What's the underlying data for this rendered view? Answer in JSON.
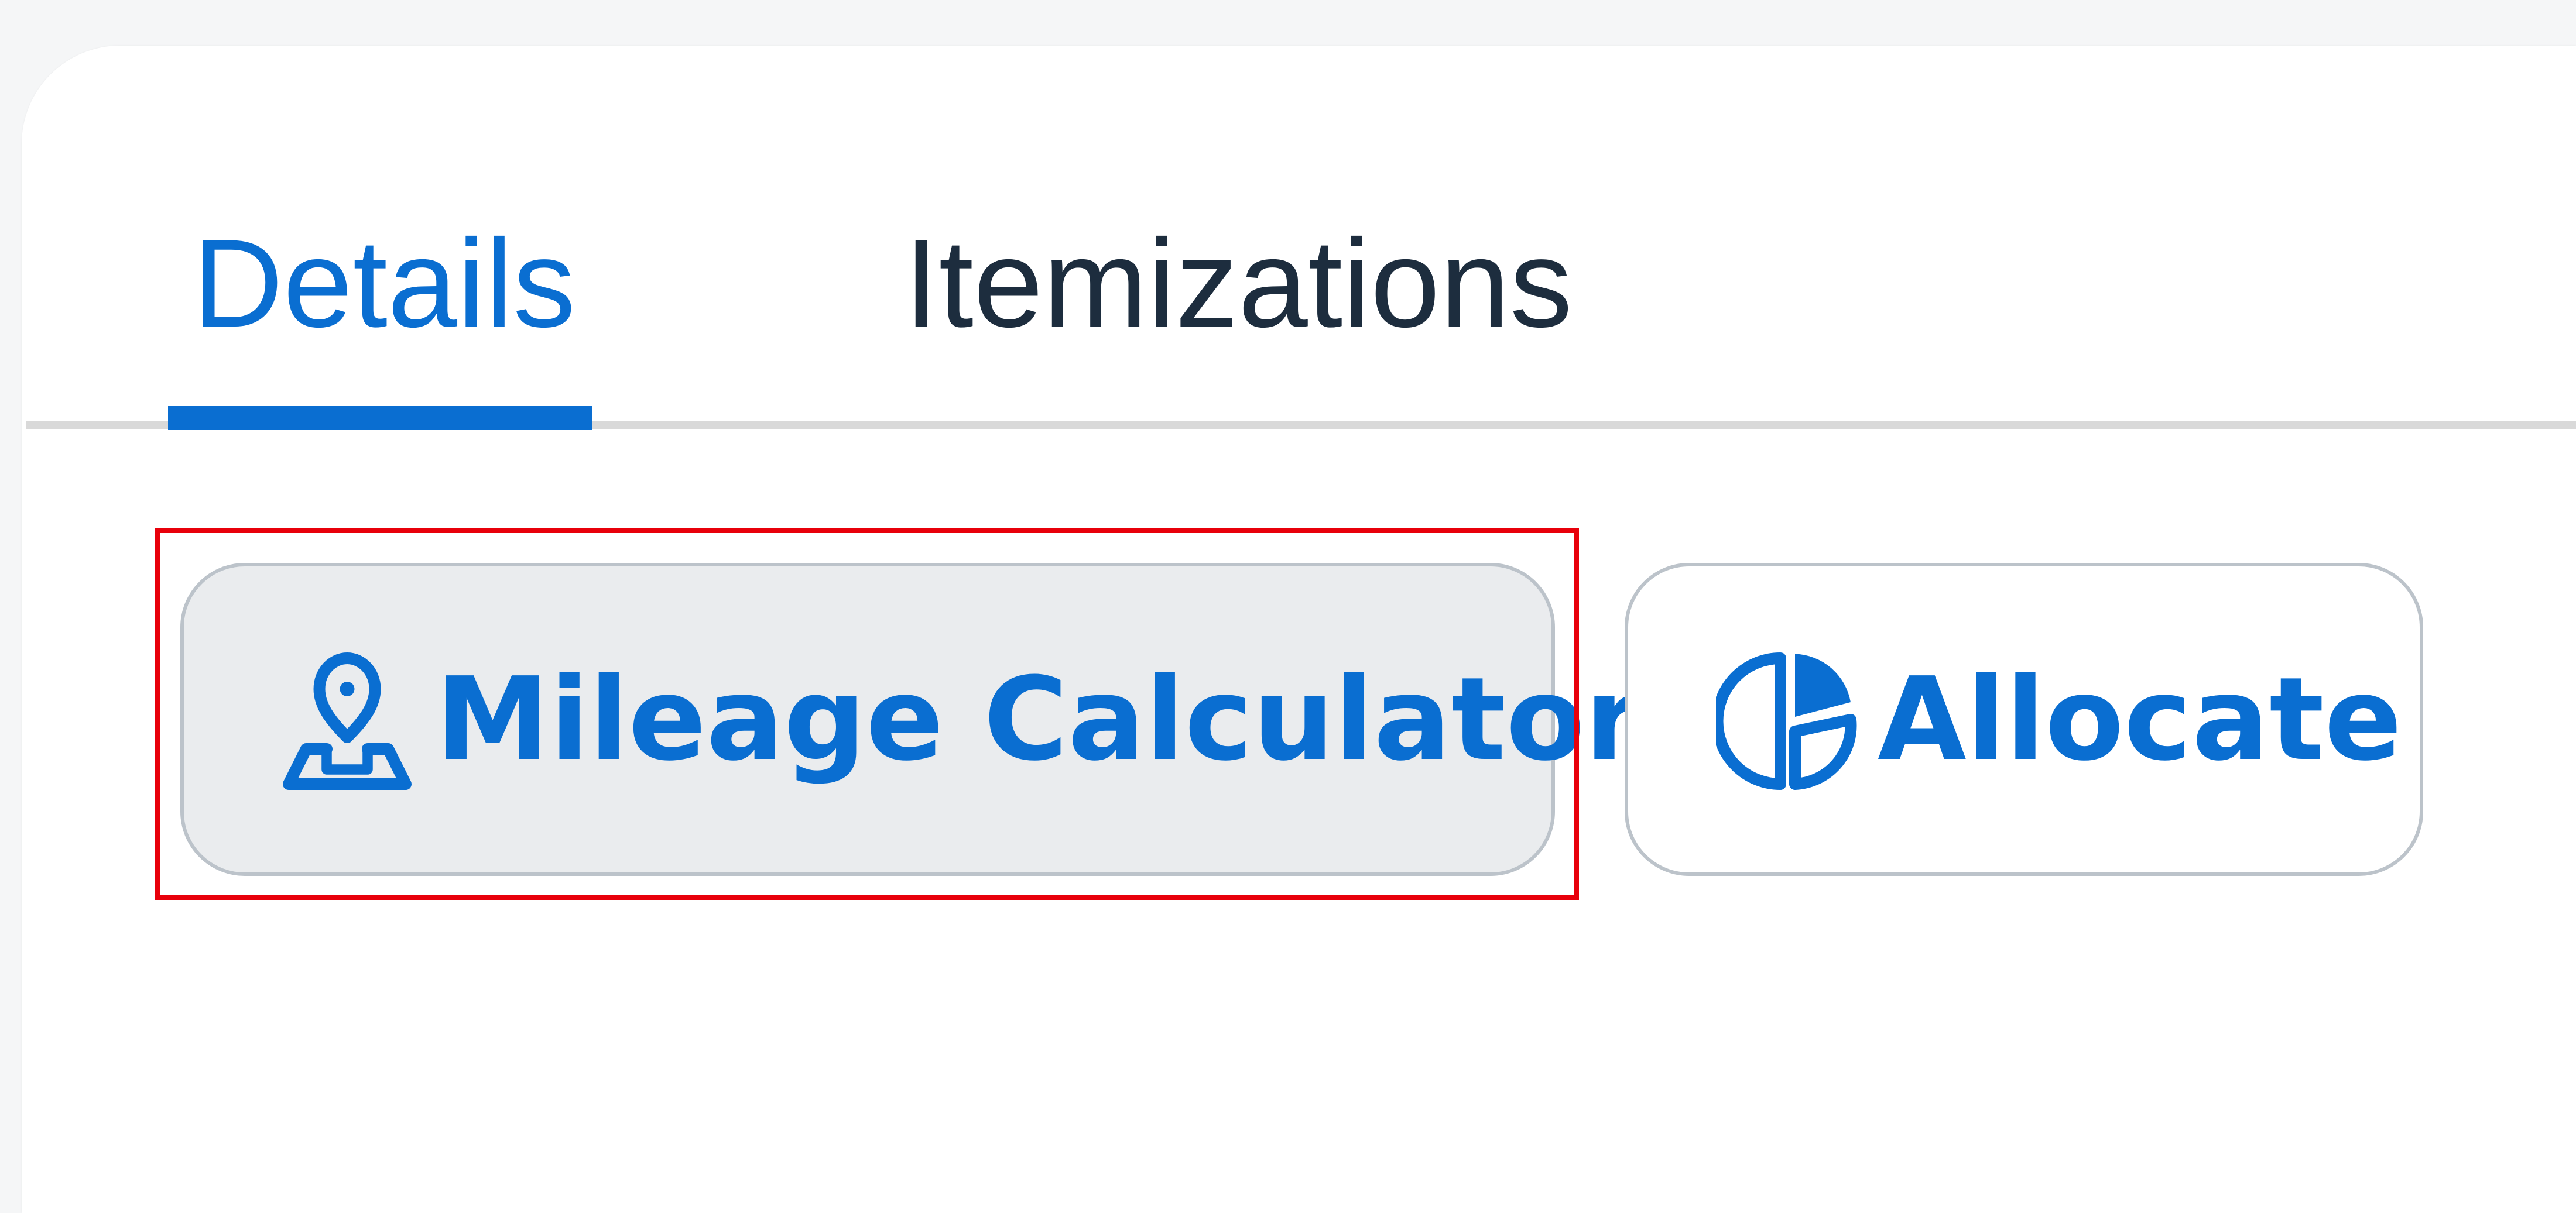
{
  "tabs": [
    {
      "label": "Details",
      "selected": true
    },
    {
      "label": "Itemizations",
      "selected": false
    }
  ],
  "toolbar": {
    "mileage_label": "Mileage Calculator",
    "mileage_icon": "map-pin-route-icon",
    "allocate_label": "Allocate",
    "allocate_icon": "pie-chart-icon"
  },
  "colors": {
    "accent": "#0a6ed1",
    "text_dark": "#1d2d3e",
    "highlight": "#e8000b"
  }
}
